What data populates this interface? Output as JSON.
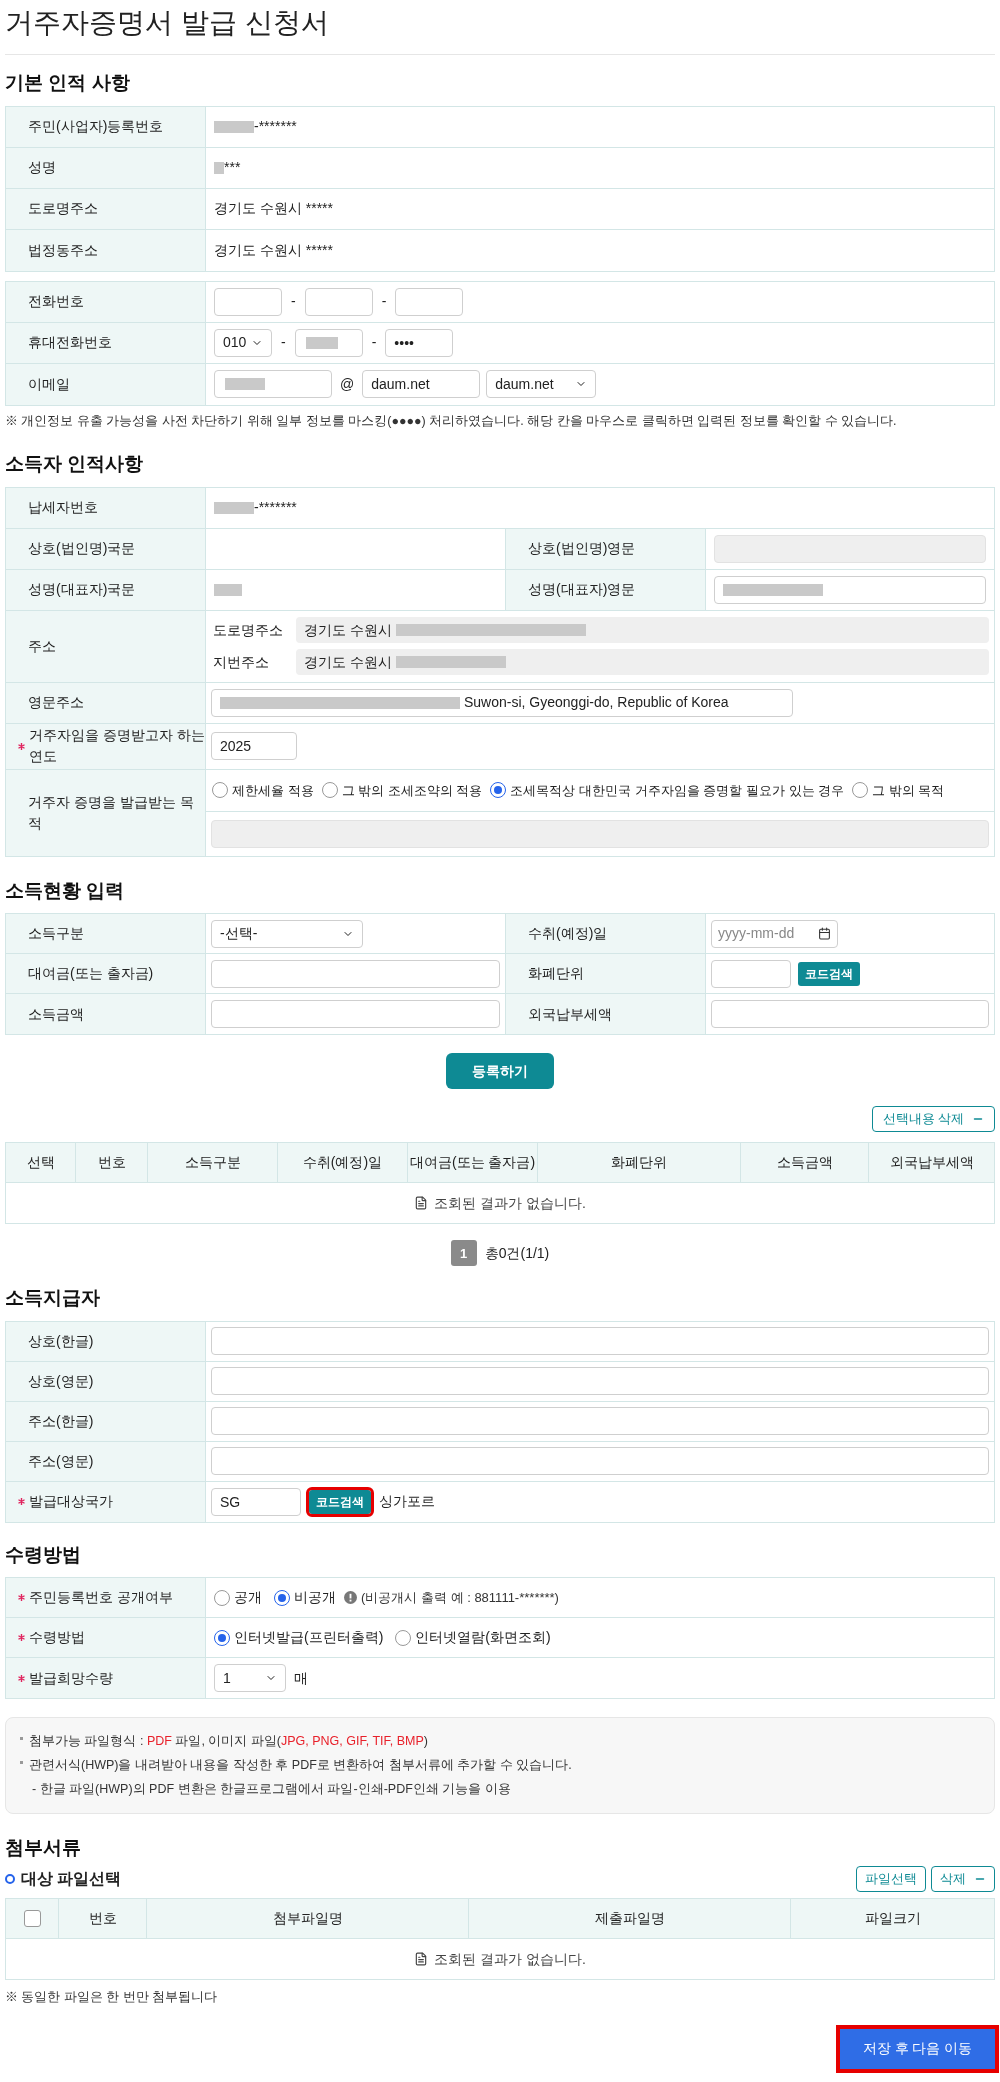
{
  "title": "거주자증명서 발급 신청서",
  "basic": {
    "heading": "기본 인적 사항",
    "rows": [
      {
        "label": "주민(사업자)등록번호",
        "redacted": true,
        "value": "-*******"
      },
      {
        "label": "성명",
        "redacted": true,
        "value": "***"
      },
      {
        "label": "도로명주소",
        "redacted": false,
        "value": "경기도 수원시 *****"
      },
      {
        "label": "법정동주소",
        "redacted": false,
        "value": "경기도 수원시 *****"
      }
    ],
    "phone": {
      "label": "전화번호",
      "separators": [
        "-",
        "-"
      ]
    },
    "mobile": {
      "label": "휴대전화번호",
      "prefix": "010",
      "separators": [
        "-",
        "-"
      ],
      "last": "••••"
    },
    "email": {
      "label": "이메일",
      "at": "@",
      "domain": "daum.net",
      "domain_select": "daum.net"
    },
    "note": "※ 개인정보 유출 가능성을 사전 차단하기 위해 일부 정보를 마스킹(●●●●) 처리하였습니다. 해당 칸을 마우스로 클릭하면 입력된 정보를 확인할 수 있습니다."
  },
  "earner": {
    "heading": "소득자 인적사항",
    "tin": {
      "label": "납세자번호",
      "value": "-*******"
    },
    "name_ko_label": "상호(법인명)국문",
    "name_en_label": "상호(법인명)영문",
    "rep_ko_label": "성명(대표자)국문",
    "rep_en_label": "성명(대표자)영문",
    "address": {
      "label": "주소",
      "lines": [
        {
          "label": "도로명주소",
          "value": "경기도 수원시"
        },
        {
          "label": "지번주소",
          "value": "경기도 수원시"
        }
      ]
    },
    "en_address": {
      "label": "영문주소",
      "value": "Suwon-si, Gyeonggi-do, Republic of Korea"
    },
    "year": {
      "label": "거주자임을 증명받고자 하는 연도",
      "required": true,
      "value": "2025"
    },
    "purpose": {
      "label": "거주자 증명을 발급받는 목적",
      "options": [
        {
          "label": "제한세율 적용",
          "selected": false
        },
        {
          "label": "그 밖의 조세조약의 적용",
          "selected": false
        },
        {
          "label": "조세목적상 대한민국 거주자임을 증명할 필요가 있는 경우",
          "selected": true
        },
        {
          "label": "그 밖의 목적",
          "selected": false
        }
      ]
    }
  },
  "income": {
    "heading": "소득현황 입력",
    "fields": [
      {
        "label": "소득구분",
        "kind": "select",
        "value": "-선택-"
      },
      {
        "label": "수취(예정)일",
        "kind": "date",
        "placeholder": "yyyy-mm-dd"
      },
      {
        "label": "대여금(또는 출자금)",
        "kind": "input"
      },
      {
        "label": "화폐단위",
        "kind": "code",
        "button": "코드검색"
      },
      {
        "label": "소득금액",
        "kind": "input"
      },
      {
        "label": "외국납부세액",
        "kind": "input"
      }
    ],
    "submit": "등록하기",
    "delete": "선택내용 삭제",
    "columns": [
      "선택",
      "번호",
      "소득구분",
      "수취(예정)일",
      "대여금(또는 출자금)",
      "화폐단위",
      "소득금액",
      "외국납부세액"
    ],
    "empty": "조회된 결과가 없습니다.",
    "pages": [
      {
        "label": "1",
        "selected": true
      }
    ],
    "summary": "총0건(1/1)"
  },
  "payer": {
    "heading": "소득지급자",
    "rows": [
      {
        "label": "상호(한글)"
      },
      {
        "label": "상호(영문)"
      },
      {
        "label": "주소(한글)"
      },
      {
        "label": "주소(영문)"
      }
    ],
    "country": {
      "label": "발급대상국가",
      "required": true,
      "code": "SG",
      "button": "코드검색",
      "highlighted": true,
      "name": "싱가포르"
    }
  },
  "receipt": {
    "heading": "수령방법",
    "rows": [
      {
        "kind": "radio",
        "label": "주민등록번호 공개여부",
        "required": true,
        "options": [
          {
            "label": "공개",
            "selected": false
          },
          {
            "label": "비공개",
            "selected": true
          }
        ],
        "hint": "(비공개시 출력 예 : 881111-*******)"
      },
      {
        "kind": "radio",
        "label": "수령방법",
        "required": true,
        "options": [
          {
            "label": "인터넷발급(프린터출력)",
            "selected": true
          },
          {
            "label": "인터넷열람(화면조회)",
            "selected": false
          }
        ]
      },
      {
        "kind": "select",
        "label": "발급희망수량",
        "required": true,
        "value": "1",
        "unit": "매"
      }
    ]
  },
  "notes": [
    {
      "kind": "bullet",
      "segments": [
        {
          "text": "첨부가능 파일형식 : ",
          "highlight": false
        },
        {
          "text": "PDF",
          "highlight": true
        },
        {
          "text": " 파일, 이미지 파일(",
          "highlight": false
        },
        {
          "text": "JPG, PNG, GIF, TIF, BMP",
          "highlight": true
        },
        {
          "text": ")",
          "highlight": false
        }
      ]
    },
    {
      "kind": "bullet",
      "segments": [
        {
          "text": "관련서식(HWP)을 내려받아 내용을 작성한 후 PDF로 변환하여 첨부서류에 추가할 수 있습니다.",
          "highlight": false
        }
      ]
    },
    {
      "kind": "sub",
      "segments": [
        {
          "text": "- 한글 파일(HWP)의 PDF 변환은 한글프로그램에서 파일-인쇄-PDF인쇄 기능을 이용",
          "highlight": false
        }
      ]
    }
  ],
  "attach": {
    "heading": "첨부서류",
    "subheading": "대상 파일선택",
    "buttons": [
      {
        "label": "파일선택",
        "kind": "plain"
      },
      {
        "label": "삭제",
        "kind": "minus"
      }
    ],
    "select_all": {
      "checked": false
    },
    "columns": [
      "번호",
      "첨부파일명",
      "제출파일명",
      "파일크기"
    ],
    "empty": "조회된 결과가 없습니다.",
    "note": "※ 동일한 파일은 한 번만 첨부됩니다"
  },
  "save": {
    "label": "저장 후 다음 이동",
    "highlighted": true
  }
}
